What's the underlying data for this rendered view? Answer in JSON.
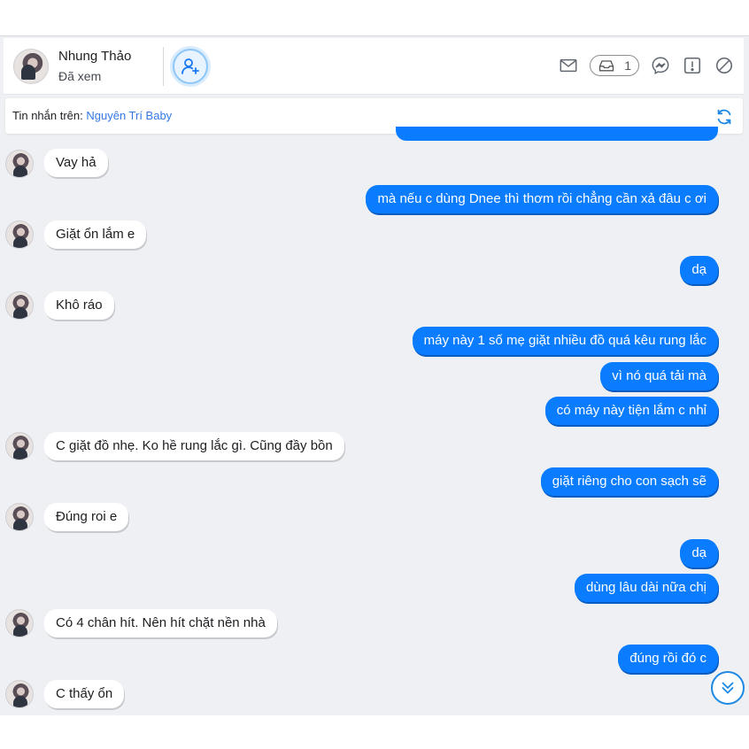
{
  "header": {
    "contact_name": "Nhung Thảo",
    "status": "Đã xem",
    "inbox_count": "1"
  },
  "info_bar": {
    "label": "Tin nhắn trên: ",
    "page_name": "Nguyên Trí Baby"
  },
  "messages": [
    {
      "from": "customer",
      "text": "Vay hả"
    },
    {
      "from": "page",
      "text": "mà nếu c dùng Dnee thì thơm rồi chẳng cần xả đâu c ơi"
    },
    {
      "from": "customer",
      "text": "Giặt ổn lắm e"
    },
    {
      "from": "page",
      "text": "dạ"
    },
    {
      "from": "customer",
      "text": "Khô ráo"
    },
    {
      "from": "page",
      "text": "máy này 1 số mẹ giặt nhiều đồ quá kêu rung lắc"
    },
    {
      "from": "page",
      "text": "vì nó quá tải mà"
    },
    {
      "from": "page",
      "text": "có máy này tiện lắm c nhỉ"
    },
    {
      "from": "customer",
      "text": "C giặt đồ nhẹ. Ko hề rung lắc gì. Cũng đầy bồn"
    },
    {
      "from": "page",
      "text": "giặt riêng cho con sạch sẽ"
    },
    {
      "from": "customer",
      "text": "Đúng roi e"
    },
    {
      "from": "page",
      "text": "dạ"
    },
    {
      "from": "page",
      "text": "dùng lâu dài nữa chị"
    },
    {
      "from": "customer",
      "text": "Có 4 chân hít. Nên hít chặt nền nhà"
    },
    {
      "from": "page",
      "text": "đúng rồi đó c"
    },
    {
      "from": "customer",
      "text": "C thấy ổn"
    }
  ],
  "icons": {
    "add_friend": "add-user-icon",
    "mail": "mail-icon",
    "inbox": "inbox-icon",
    "messenger": "messenger-icon",
    "report": "report-icon",
    "block": "block-icon",
    "refresh": "refresh-icon",
    "scroll_down": "double-chevron-down-icon"
  },
  "colors": {
    "outgoing_bubble": "#0a7cff",
    "incoming_bubble": "#ffffff",
    "accent": "#1e88e5",
    "background": "#eef0f3"
  }
}
